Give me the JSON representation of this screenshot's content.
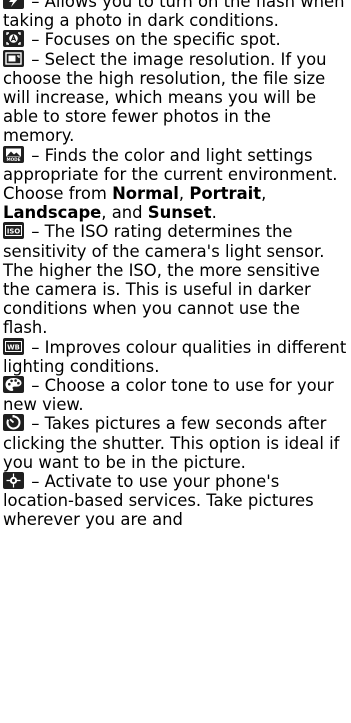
{
  "items": [
    {
      "icon": "flash-icon",
      "text": " – Allows you to turn on the flash when taking a photo in dark conditions."
    },
    {
      "icon": "auto-focus-icon",
      "text": " – Focuses on the specific spot."
    },
    {
      "icon": "resolution-icon",
      "text": " – Select the image resolution. If you choose the high resolution, the file size will increase, which means you will be able to store fewer photos in the memory."
    },
    {
      "icon": "scene-mode-icon",
      "text": " – Finds the color and light settings appropriate for the current environment. Choose from ",
      "options": [
        "Normal",
        "Portrait",
        "Landscape",
        "Sunset"
      ],
      "sep1": ", ",
      "sep2": ", ",
      "sep3": ", and ",
      "end": "."
    },
    {
      "icon": "iso-icon",
      "text": " – The ISO rating determines the sensitivity of the camera's light sensor. The higher the ISO, the more sensitive the camera is. This is useful in darker conditions when you cannot use the flash."
    },
    {
      "icon": "white-balance-icon",
      "text": " – Improves colour qualities in different lighting conditions."
    },
    {
      "icon": "color-effects-icon",
      "text": " – Choose a color tone to use for your new view."
    },
    {
      "icon": "self-timer-icon",
      "text": " – Takes pictures a few seconds after clicking the shutter. This option is ideal if you want to be in the picture."
    },
    {
      "icon": "geotag-icon",
      "text": " – Activate to use your phone's location-based services. Take pictures wherever you are and"
    }
  ],
  "icon_labels": {
    "iso": "ISO",
    "wb": "WB",
    "mode": "MODE"
  },
  "colors": {
    "icon_bg": "#1f1f1f",
    "icon_fg": "#ffffff",
    "text": "#000000"
  }
}
